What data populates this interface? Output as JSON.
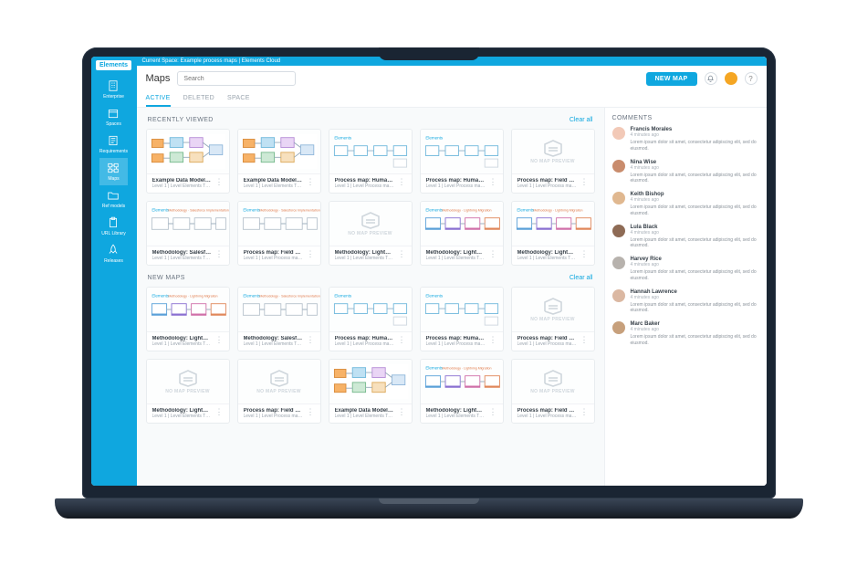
{
  "window": {
    "title": "Current Space: Example process maps | Elements Cloud"
  },
  "brand": "Elements",
  "sidebar": {
    "items": [
      {
        "label": "Enterprise",
        "icon": "building-icon"
      },
      {
        "label": "Spaces",
        "icon": "box-icon"
      },
      {
        "label": "Requirements",
        "icon": "list-icon"
      },
      {
        "label": "Maps",
        "icon": "map-icon",
        "active": true
      },
      {
        "label": "Ref models",
        "icon": "folder-icon"
      },
      {
        "label": "URL Library",
        "icon": "clipboard-icon"
      },
      {
        "label": "Releases",
        "icon": "rocket-icon"
      }
    ]
  },
  "header": {
    "page_title": "Maps",
    "search_placeholder": "Search",
    "new_button": "NEW MAP"
  },
  "tabs": [
    {
      "label": "ACTIVE",
      "active": true
    },
    {
      "label": "DELETED"
    },
    {
      "label": "SPACE"
    }
  ],
  "sections": [
    {
      "title": "RECENTLY VIEWED",
      "clear": "Clear all",
      "cards": [
        {
          "title": "Example Data Model to suppo…",
          "sub": "Level 1 | Level Elements Tutorial",
          "thumb": "flow-orange"
        },
        {
          "title": "Example Data Model to suppo…",
          "sub": "Level 1 | Level Elements Tutorial",
          "thumb": "flow-orange"
        },
        {
          "title": "Process map: Human Capital …",
          "sub": "Level 1 | Level Process map: Hu…",
          "thumb": "flow-line"
        },
        {
          "title": "Process map: Human Capital …",
          "sub": "Level 1 | Level Process map: Hu…",
          "thumb": "flow-line"
        },
        {
          "title": "Process map: Field Service",
          "sub": "Level 1 | Level Process map: Fie…",
          "thumb": "none"
        },
        {
          "title": "Methodology: Salesforce Impl…",
          "sub": "Level 1 | Level Elements Tutorial",
          "thumb": "flow-steps"
        },
        {
          "title": "Process map: Field Service",
          "sub": "Level 1 | Level Process map: Fie…",
          "thumb": "flow-steps"
        },
        {
          "title": "Methodology: Lightning Migrati.",
          "sub": "Level 1 | Level Elements Tutorial",
          "thumb": "none"
        },
        {
          "title": "Methodology: Lightning Migrati.",
          "sub": "Level 1 | Level Elements Tutorial",
          "thumb": "flow-gradient"
        },
        {
          "title": "Methodology: Lightning Migrati.",
          "sub": "Level 1 | Level Elements Tutorial",
          "thumb": "flow-gradient"
        }
      ]
    },
    {
      "title": "NEW MAPS",
      "clear": "Clear all",
      "cards": [
        {
          "title": "Methodology: Lightning Migrati.",
          "sub": "Level 1 | Level Elements Tutorial",
          "thumb": "flow-gradient"
        },
        {
          "title": "Methodology: Salesforce Impl…",
          "sub": "Level 1 | Level Elements Tutorial",
          "thumb": "flow-steps"
        },
        {
          "title": "Process map: Human Capital …",
          "sub": "Level 1 | Level Process map: Hu…",
          "thumb": "flow-line"
        },
        {
          "title": "Process map: Human Capital …",
          "sub": "Level 1 | Level Process map: Hu…",
          "thumb": "flow-line"
        },
        {
          "title": "Process map: Field Service",
          "sub": "Level 1 | Level Process map: Fie…",
          "thumb": "none"
        },
        {
          "title": "Methodology: Lightning Migrati.",
          "sub": "Level 1 | Level Elements Tutorial",
          "thumb": "none"
        },
        {
          "title": "Process map: Field Service",
          "sub": "Level 1 | Level Process map: Fie…",
          "thumb": "none"
        },
        {
          "title": "Example Data Model to suppo…",
          "sub": "Level 1 | Level Elements Tutorial",
          "thumb": "flow-orange"
        },
        {
          "title": "Methodology: Lightning Migrati.",
          "sub": "Level 1 | Level Elements Tutorial",
          "thumb": "flow-gradient"
        },
        {
          "title": "Process map: Field Service",
          "sub": "Level 1 | Level Process map: Fie…",
          "thumb": "none"
        }
      ]
    }
  ],
  "comments": {
    "title": "COMMENTS",
    "items": [
      {
        "name": "Francis Morales",
        "time": "4 minutes ago",
        "text": "Lorem ipsum dolor sit amet, consectetur adipiscing elit, sed do eiusmod.",
        "color": "#f2c9b7"
      },
      {
        "name": "Nina Wise",
        "time": "4 minutes ago",
        "text": "Lorem ipsum dolor sit amet, consectetur adipiscing elit, sed do eiusmod.",
        "color": "#c98c6d"
      },
      {
        "name": "Keith Bishop",
        "time": "4 minutes ago",
        "text": "Lorem ipsum dolor sit amet, consectetur adipiscing elit, sed do eiusmod.",
        "color": "#e0b890"
      },
      {
        "name": "Lula Black",
        "time": "4 minutes ago",
        "text": "Lorem ipsum dolor sit amet, consectetur adipiscing elit, sed do eiusmod.",
        "color": "#8e6b55"
      },
      {
        "name": "Harvey Rice",
        "time": "4 minutes ago",
        "text": "Lorem ipsum dolor sit amet, consectetur adipiscing elit, sed do eiusmod.",
        "color": "#b7b2ad"
      },
      {
        "name": "Hannah Lawrence",
        "time": "4 minutes ago",
        "text": "Lorem ipsum dolor sit amet, consectetur adipiscing elit, sed do eiusmod.",
        "color": "#dbb8a2"
      },
      {
        "name": "Marc Baker",
        "time": "4 minutes ago",
        "text": "Lorem ipsum dolor sit amet, consectetur adipiscing elit, sed do eiusmod.",
        "color": "#c7a07c"
      }
    ]
  },
  "no_preview_label": "NO MAP PREVIEW"
}
